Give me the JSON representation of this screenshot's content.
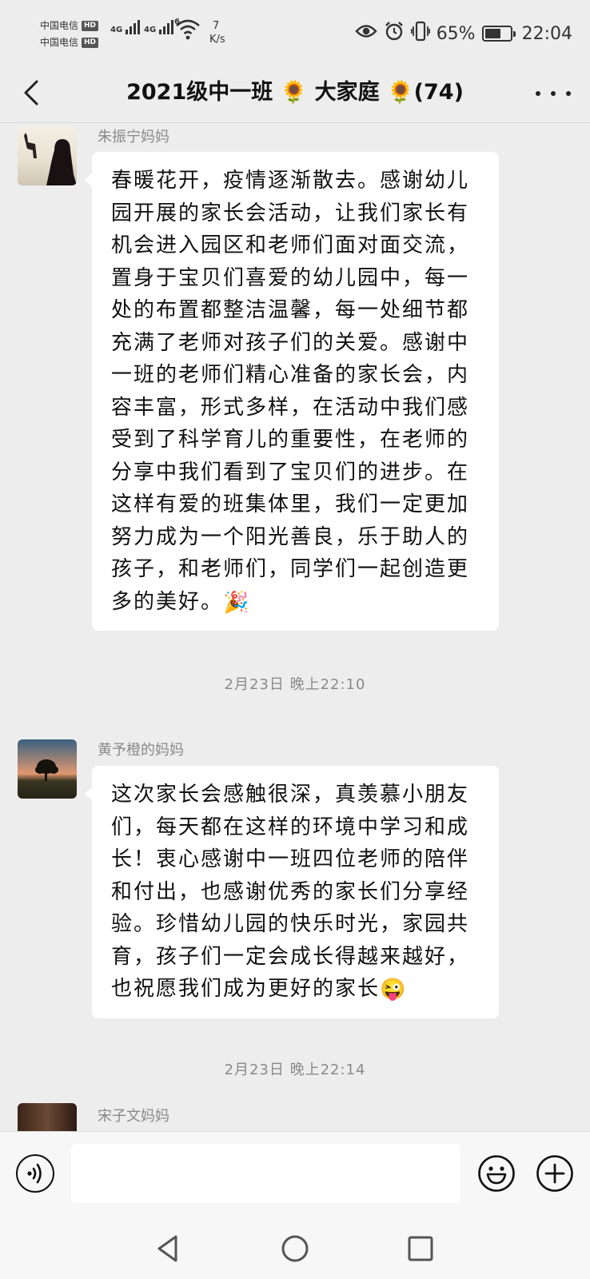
{
  "status_bar": {
    "carrier_1": "中国电信",
    "carrier_2": "中国电信",
    "hd_badge": "HD",
    "network_1": "4G",
    "network_2": "4G",
    "wifi_number": "6",
    "speed_value": "7",
    "speed_unit": "K/s",
    "battery_percent": "65%",
    "battery_level": 0.65,
    "time": "22:04",
    "icons": [
      "eye-icon",
      "alarm-icon",
      "vibrate-icon",
      "battery-icon"
    ]
  },
  "header": {
    "title": "2021级中一班 🌻 大家庭 🌻(74)",
    "back_icon": "chevron-left-icon",
    "more_icon": "more-horizontal-icon"
  },
  "messages": [
    {
      "sender": "朱振宁妈妈",
      "text": "春暖花开，疫情逐渐散去。感谢幼儿园开展的家长会活动，让我们家长有机会进入园区和老师们面对面交流，置身于宝贝们喜爱的幼儿园中，每一处的布置都整洁温馨，每一处细节都充满了老师对孩子们的关爱。感谢中一班的老师们精心准备的家长会，内容丰富，形式多样，在活动中我们感受到了科学育儿的重要性，在老师的分享中我们看到了宝贝们的进步。在这样有爱的班集体里，我们一定更加努力成为一个阳光善良，乐于助人的孩子，和老师们，同学们一起创造更多的美好。",
      "emoji": "🎉",
      "timestamp": "2月23日 晚上22:10"
    },
    {
      "sender": "黄予橙的妈妈",
      "text": "这次家长会感触很深，真羡慕小朋友们，每天都在这样的环境中学习和成长！衷心感谢中一班四位老师的陪伴和付出，也感谢优秀的家长们分享经验。珍惜幼儿园的快乐时光，家园共育，孩子们一定会成长得越来越好，也祝愿我们成为更好的家长",
      "emoji": "😜",
      "timestamp": "2月23日 晚上22:14"
    },
    {
      "sender": "宋子文妈妈"
    }
  ],
  "input_bar": {
    "placeholder": "",
    "voice_icon": "voice-icon",
    "emoji_icon": "smiley-icon",
    "plus_icon": "plus-circle-icon"
  },
  "nav_bar": {
    "back_icon": "triangle-back-icon",
    "home_icon": "circle-home-icon",
    "recents_icon": "square-recents-icon"
  }
}
